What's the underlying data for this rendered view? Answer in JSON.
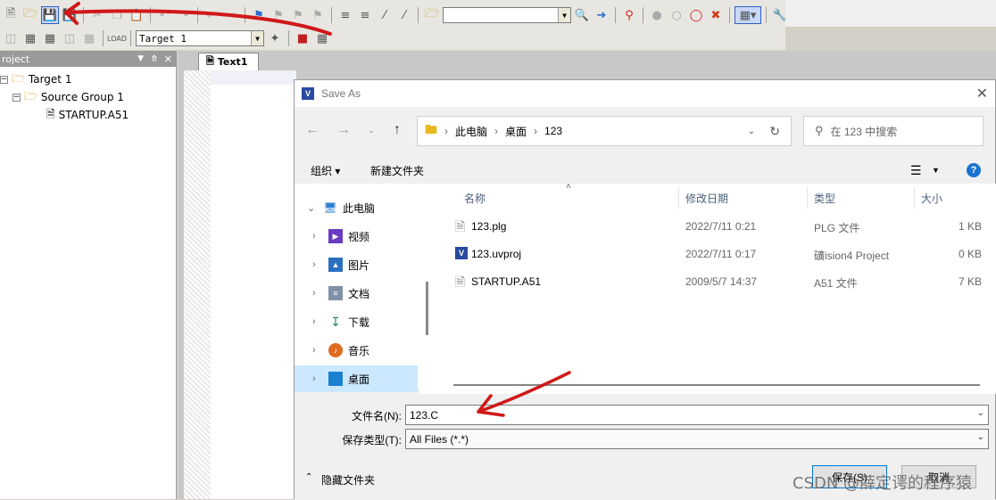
{
  "toolbar": {
    "target_combo": "Target 1",
    "red_arrow_color": "#d01818",
    "icons_row1": [
      "new-file-icon",
      "open-folder-icon",
      "save-icon",
      "save-all-icon",
      "cut-icon",
      "copy-icon",
      "paste-icon",
      "undo-icon",
      "redo-icon",
      "back-icon",
      "forward-icon",
      "bookmark-icon",
      "bookmark-prev-icon",
      "bookmark-next-icon",
      "bookmark-clear-icon",
      "indent-icon",
      "unindent-icon",
      "comment-icon",
      "uncomment-icon",
      "find-in-files-icon",
      "find-icon",
      "debug-icon",
      "breakpoint-icon",
      "breakpoint-disable-icon",
      "breakpoint-kill-icon",
      "window-icon",
      "tools-icon"
    ],
    "icons_row2": [
      "translate-icon",
      "build-icon",
      "rebuild-icon",
      "batch-icon",
      "stop-icon",
      "load-icon",
      "options-icon",
      "pack-icon",
      "manage-icon"
    ]
  },
  "project_panel": {
    "title": "roject",
    "tree": [
      {
        "label": "Target 1",
        "level": 0
      },
      {
        "label": "Source Group 1",
        "level": 1
      },
      {
        "label": "STARTUP.A51",
        "level": 2
      }
    ]
  },
  "editor": {
    "tab_label": "Text1"
  },
  "dialog": {
    "title": "Save As",
    "breadcrumb": [
      "此电脑",
      "桌面",
      "123"
    ],
    "search_placeholder": "在 123 中搜索",
    "organize_label": "组织 ▾",
    "new_folder_label": "新建文件夹",
    "nav": [
      {
        "label": "此电脑",
        "icon": "pc-icon",
        "expanded": true
      },
      {
        "label": "视频",
        "icon": "video-icon"
      },
      {
        "label": "图片",
        "icon": "picture-icon"
      },
      {
        "label": "文档",
        "icon": "document-icon"
      },
      {
        "label": "下载",
        "icon": "download-icon"
      },
      {
        "label": "音乐",
        "icon": "music-icon"
      },
      {
        "label": "桌面",
        "icon": "desktop-icon",
        "selected": true
      }
    ],
    "columns": {
      "name": "名称",
      "modified": "修改日期",
      "type": "类型",
      "size": "大小"
    },
    "files": [
      {
        "name": "123.plg",
        "modified": "2022/7/11 0:21",
        "type": "PLG 文件",
        "size": "1 KB",
        "icon": "file-icon"
      },
      {
        "name": "123.uvproj",
        "modified": "2022/7/11 0:17",
        "type": "礦ision4 Project",
        "size": "0 KB",
        "icon": "uvision-icon"
      },
      {
        "name": "STARTUP.A51",
        "modified": "2009/5/7 14:37",
        "type": "A51 文件",
        "size": "7 KB",
        "icon": "file-icon"
      }
    ],
    "filename_label": "文件名(N):",
    "filename_value": "123.C",
    "filetype_label": "保存类型(T):",
    "filetype_value": "All Files (*.*)",
    "hide_folders_label": "隐藏文件夹",
    "save_label": "保存(S)",
    "cancel_label": "取消"
  },
  "watermark": "CSDN @薛定谔的程序猿"
}
